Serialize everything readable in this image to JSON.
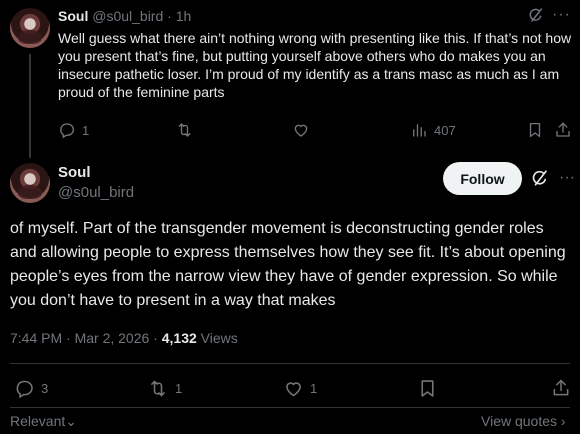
{
  "reply_tweet": {
    "name": "Soul",
    "handle": "@s0ul_bird",
    "separator": "·",
    "time": "1h",
    "more": "···",
    "text": "Well guess what there ain’t nothing wrong with presenting like this. If that’s not how you present that’s fine, but putting yourself above others who do makes you an insecure pathetic loser. I’m proud of my identify as a trans masc as much as I am proud of the feminine parts",
    "replies": "1",
    "views": "407"
  },
  "main_tweet": {
    "name": "Soul",
    "handle": "@s0ul_bird",
    "follow_label": "Follow",
    "more": "···",
    "text": "of myself. Part of the transgender movement is deconstructing gender roles and allowing people to express themselves how they see fit. It’s about opening people’s eyes from the narrow view they have of gender expression. So while you don’t have to present in a way that makes",
    "timestamp": "7:44 PM · Mar 2, 2026 · ",
    "views_count": "4,132",
    "views_label": " Views",
    "replies": "3",
    "reposts": "1",
    "likes": "1"
  },
  "footer": {
    "relevant_label": "Relevant",
    "relevant_chevron": "⌄",
    "view_quotes_label": "View quotes",
    "view_quotes_chevron": "›"
  }
}
